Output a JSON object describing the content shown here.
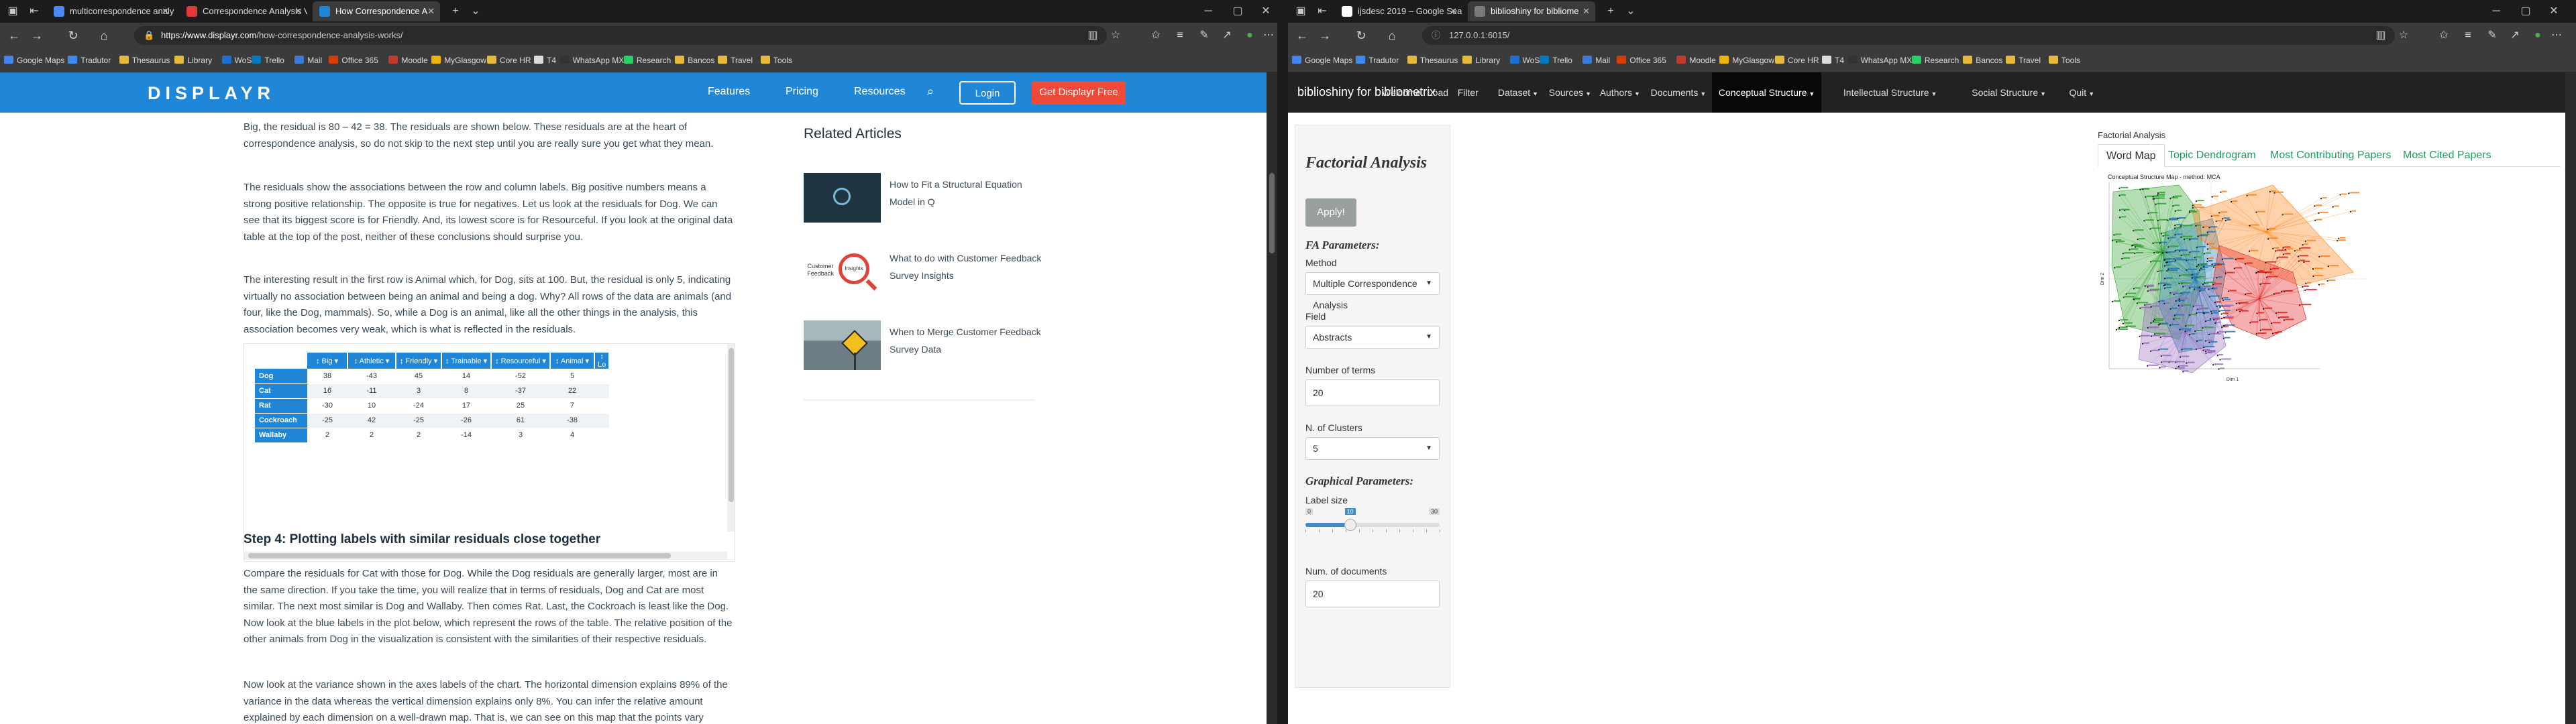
{
  "left_window": {
    "tabs": [
      {
        "title": "multicorrespondence analysi"
      },
      {
        "title": "Correspondence Analysis Vi"
      },
      {
        "title": "How Correspondence A"
      }
    ],
    "url": {
      "host": "https://www.displayr.com",
      "path": "/how-correspondence-analysis-works/"
    },
    "favorites": [
      "Google Maps",
      "Tradutor",
      "Thesaurus",
      "Library",
      "WoS",
      "Trello",
      "Mail",
      "Office 365",
      "Moodle",
      "MyGlasgow",
      "Core HR",
      "T4",
      "WhatsApp MX",
      "Research",
      "Bancos",
      "Travel",
      "Tools"
    ],
    "site": {
      "logo": "DISPLAYR",
      "nav": [
        "Features",
        "Pricing",
        "Resources"
      ],
      "login": "Login",
      "cta": "Get Displayr Free"
    },
    "article": {
      "para1": "Big, the residual is 80 – 42 = 38. The residuals are shown below. These residuals are at the heart of correspondence analysis, so do not skip to the next step until you are really sure you get what they mean.",
      "para2": "The residuals show the associations between the row and column labels. Big positive numbers means a strong positive relationship. The opposite is true for negatives. Let us look at the residuals for Dog. We can see that its biggest score is for Friendly. And, its lowest score is for Resourceful. If you look at the original data table at the top of the post, neither of these conclusions should surprise you.",
      "para3": "The interesting result in the first row is Animal which, for Dog, sits at 100. But, the residual is only 5, indicating virtually no association between being an animal and being a dog. Why? All rows of the data are animals (and four, like the Dog, mammals). So, while a Dog is an animal, like all the other things in the analysis, this association becomes very weak, which is what is reflected in the residuals.",
      "table": {
        "headers": [
          "Big",
          "Athletic",
          "Friendly",
          "Trainable",
          "Resourceful",
          "Animal",
          "Lo"
        ],
        "rows": [
          {
            "label": "Dog",
            "values": [
              "38",
              "-43",
              "45",
              "14",
              "-52",
              "5"
            ]
          },
          {
            "label": "Cat",
            "values": [
              "16",
              "-11",
              "3",
              "8",
              "-37",
              "22"
            ]
          },
          {
            "label": "Rat",
            "values": [
              "-30",
              "10",
              "-24",
              "17",
              "25",
              "7"
            ]
          },
          {
            "label": "Cockroach",
            "values": [
              "-25",
              "42",
              "-25",
              "-26",
              "61",
              "-38"
            ]
          },
          {
            "label": "Wallaby",
            "values": [
              "2",
              "2",
              "2",
              "-14",
              "3",
              "4"
            ]
          }
        ]
      },
      "step4": "Step 4: Plotting labels with similar residuals close together",
      "para4": "Compare the residuals for Cat with those for Dog. While the Dog residuals are generally larger, most are in the same direction. If you take the time, you will realize that in terms of residuals, Dog and Cat are most similar. The next most similar is Dog and Wallaby. Then comes Rat. Last, the Cockroach is least like the Dog. Now look at the blue labels in the plot below, which represent the rows of the table. The relative position of the other animals from Dog in the visualization is consistent with the similarities of their respective residuals.",
      "para5": "Now look at the variance shown in the axes labels of the chart. The horizontal dimension explains 89% of the variance in the data whereas the vertical dimension explains only 8%. You can infer the relative amount explained by each dimension on a well-drawn map. That is, we can see on this map that the points vary"
    },
    "related": {
      "title": "Related Articles",
      "items": [
        {
          "title": "How to Fit a Structural Equation Model in Q"
        },
        {
          "title": "What to do with Customer Feedback Survey Insights",
          "thumb_left": "Customer Feedback",
          "thumb_right": "Insights"
        },
        {
          "title": "When to Merge Customer Feedback Survey Data"
        }
      ]
    }
  },
  "right_window": {
    "tabs": [
      {
        "title": "ijsdesc 2019 – Google Search"
      },
      {
        "title": "biblioshiny for bibliome"
      }
    ],
    "url": {
      "text": "127.0.0.1:6015/"
    },
    "favorites": [
      "Google Maps",
      "Tradutor",
      "Thesaurus",
      "Library",
      "WoS",
      "Trello",
      "Mail",
      "Office 365",
      "Moodle",
      "MyGlasgow",
      "Core HR",
      "T4",
      "WhatsApp MX",
      "Research",
      "Bancos",
      "Travel",
      "Tools"
    ],
    "app": {
      "brand": "biblioshiny for bibliometrix",
      "menu": [
        {
          "label": "Welcome",
          "dropdown": false
        },
        {
          "label": "Load",
          "dropdown": false
        },
        {
          "label": "Filter",
          "dropdown": false
        },
        {
          "label": "Dataset",
          "dropdown": true
        },
        {
          "label": "Sources",
          "dropdown": true
        },
        {
          "label": "Authors",
          "dropdown": true
        },
        {
          "label": "Documents",
          "dropdown": true
        },
        {
          "label": "Conceptual Structure",
          "dropdown": true,
          "active": true
        },
        {
          "label": "Intellectual Structure",
          "dropdown": true
        },
        {
          "label": "Social Structure",
          "dropdown": true
        },
        {
          "label": "Quit",
          "dropdown": true
        }
      ],
      "sidebar": {
        "title": "Factorial Analysis",
        "apply": "Apply!",
        "fa_params": "FA Parameters:",
        "method_label": "Method",
        "method_value": "Multiple Correspondence Analysis",
        "field_label": "Field",
        "field_value": "Abstracts",
        "terms_label": "Number of terms",
        "terms_value": "20",
        "clusters_label": "N. of Clusters",
        "clusters_value": "5",
        "graph_params": "Graphical Parameters:",
        "labelsize_label": "Label size",
        "labelsize": {
          "min": "0",
          "max": "30",
          "value": 10
        },
        "docs_label": "Num. of documents",
        "docs_value": "20"
      },
      "panel_label": "Factorial Analysis",
      "main_tabs": [
        "Word Map",
        "Topic Dendrogram",
        "Most Contributing Papers",
        "Most Cited Papers"
      ],
      "plot": {
        "title": "Conceptual Structure Map - method: MCA",
        "xlabel": "Dim 1",
        "ylabel": "Dim 2",
        "colors": {
          "green": "#2ca02c",
          "blue": "#1f77b4",
          "orange": "#ff7f0e",
          "red": "#e31a1c",
          "purple": "#9467bd"
        }
      }
    }
  }
}
